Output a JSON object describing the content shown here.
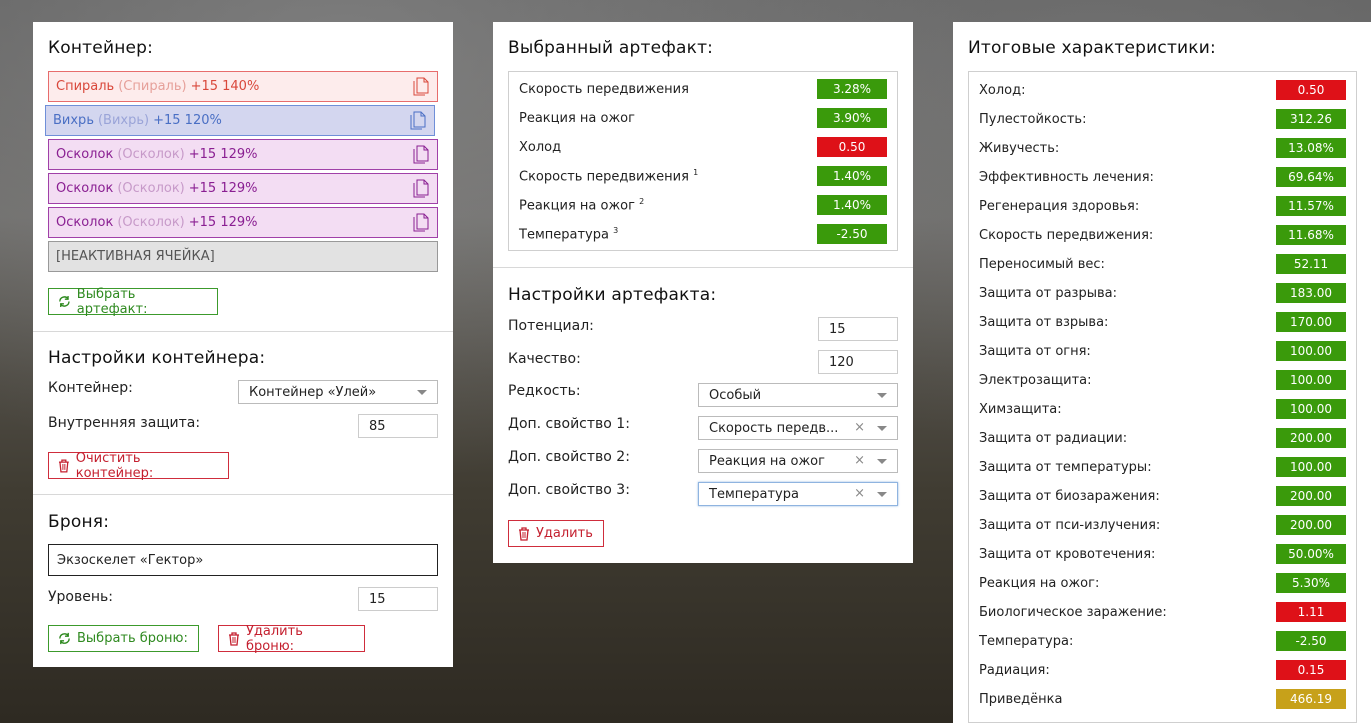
{
  "container_panel": {
    "title": "Контейнер:",
    "slots": [
      {
        "name": "Спираль",
        "orig": "(Спираль)",
        "level": "+15 140%"
      },
      {
        "name": "Вихрь",
        "orig": "(Вихрь)",
        "level": "+15 120%"
      },
      {
        "name": "Осколок",
        "orig": "(Осколок)",
        "level": "+15 129%"
      },
      {
        "name": "Осколок",
        "orig": "(Осколок)",
        "level": "+15 129%"
      },
      {
        "name": "Осколок",
        "orig": "(Осколок)",
        "level": "+15 129%"
      }
    ],
    "inactive_slot": "[НЕАКТИВНАЯ ЯЧЕЙКА]",
    "choose_artifact_btn": "Выбрать артефакт:",
    "settings_title": "Настройки контейнера:",
    "container_label": "Контейнер:",
    "container_value": "Контейнер «Улей»",
    "inner_protection_label": "Внутренняя защита:",
    "inner_protection_value": "85",
    "clear_btn": "Очистить контейнер:",
    "armor_title": "Броня:",
    "armor_value": "Экзоскелет «Гектор»",
    "level_label": "Уровень:",
    "level_value": "15",
    "choose_armor_btn": "Выбрать броню:",
    "delete_armor_btn": "Удалить броню:"
  },
  "artifact_panel": {
    "title": "Выбранный артефакт:",
    "stats": [
      {
        "label": "Скорость передвижения",
        "sup": "",
        "value": "3.28%",
        "color": "#3a9a0b"
      },
      {
        "label": "Реакция на ожог",
        "sup": "",
        "value": "3.90%",
        "color": "#3a9a0b"
      },
      {
        "label": "Холод",
        "sup": "",
        "value": "0.50",
        "color": "#de1118"
      },
      {
        "label": "Скорость передвижения",
        "sup": "1",
        "value": "1.40%",
        "color": "#3a9a0b"
      },
      {
        "label": "Реакция на ожог",
        "sup": "2",
        "value": "1.40%",
        "color": "#3a9a0b"
      },
      {
        "label": "Температура",
        "sup": "3",
        "value": "-2.50",
        "color": "#3a9a0b"
      }
    ],
    "settings_title": "Настройки артефакта:",
    "potential_label": "Потенциал:",
    "potential_value": "15",
    "quality_label": "Качество:",
    "quality_value": "120",
    "rarity_label": "Редкость:",
    "rarity_value": "Особый",
    "extra1_label": "Доп. свойство 1:",
    "extra1_value": "Скорость передв...",
    "extra2_label": "Доп. свойство 2:",
    "extra2_value": "Реакция на ожог",
    "extra3_label": "Доп. свойство 3:",
    "extra3_value": "Температура",
    "clear_symbol": "×",
    "delete_btn": "Удалить"
  },
  "totals_panel": {
    "title": "Итоговые характеристики:",
    "stats": [
      {
        "label": "Холод:",
        "value": "0.50",
        "color": "#de1118"
      },
      {
        "label": "Пулестойкость:",
        "value": "312.26",
        "color": "#3a9a0b"
      },
      {
        "label": "Живучесть:",
        "value": "13.08%",
        "color": "#3a9a0b"
      },
      {
        "label": "Эффективность лечения:",
        "value": "69.64%",
        "color": "#3a9a0b"
      },
      {
        "label": "Регенерация здоровья:",
        "value": "11.57%",
        "color": "#3a9a0b"
      },
      {
        "label": "Скорость передвижения:",
        "value": "11.68%",
        "color": "#3a9a0b"
      },
      {
        "label": "Переносимый вес:",
        "value": "52.11",
        "color": "#3a9a0b"
      },
      {
        "label": "Защита от разрыва:",
        "value": "183.00",
        "color": "#3a9a0b"
      },
      {
        "label": "Защита от взрыва:",
        "value": "170.00",
        "color": "#3a9a0b"
      },
      {
        "label": "Защита от огня:",
        "value": "100.00",
        "color": "#3a9a0b"
      },
      {
        "label": "Электрозащита:",
        "value": "100.00",
        "color": "#3a9a0b"
      },
      {
        "label": "Химзащита:",
        "value": "100.00",
        "color": "#3a9a0b"
      },
      {
        "label": "Защита от радиации:",
        "value": "200.00",
        "color": "#3a9a0b"
      },
      {
        "label": "Защита от температуры:",
        "value": "100.00",
        "color": "#3a9a0b"
      },
      {
        "label": "Защита от биозаражения:",
        "value": "200.00",
        "color": "#3a9a0b"
      },
      {
        "label": "Защита от пси-излучения:",
        "value": "200.00",
        "color": "#3a9a0b"
      },
      {
        "label": "Защита от кровотечения:",
        "value": "50.00%",
        "color": "#3a9a0b"
      },
      {
        "label": "Реакция на ожог:",
        "value": "5.30%",
        "color": "#3a9a0b"
      },
      {
        "label": "Биологическое заражение:",
        "value": "1.11",
        "color": "#de1118"
      },
      {
        "label": "Температура:",
        "value": "-2.50",
        "color": "#3a9a0b"
      },
      {
        "label": "Радиация:",
        "value": "0.15",
        "color": "#de1118"
      },
      {
        "label": "Приведёнка",
        "value": "466.19",
        "color": "#c7a11a"
      }
    ]
  }
}
